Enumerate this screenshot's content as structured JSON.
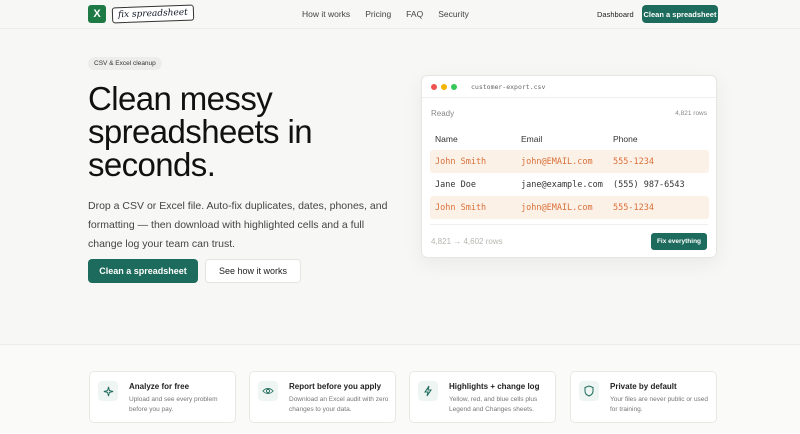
{
  "nav": {
    "logo_icon": "X",
    "logo_text": "fix spreadsheet",
    "links": [
      "How it works",
      "Pricing",
      "FAQ",
      "Security"
    ],
    "dashboard": "Dashboard",
    "cta": "Clean a spreadsheet"
  },
  "hero": {
    "pill": "CSV & Excel cleanup",
    "title": "Clean messy spreadsheets in seconds.",
    "description": "Drop a CSV or Excel file. Auto-fix duplicates, dates, phones, and formatting — then download with highlighted cells and a full change log your team can trust.",
    "primary_button": "Clean a spreadsheet",
    "secondary_button": "See how it works"
  },
  "preview": {
    "filename": "customer-export.csv",
    "status": "Ready",
    "rows_label": "4,821 rows",
    "columns": [
      "Name",
      "Email",
      "Phone"
    ],
    "rows": [
      {
        "name": "John Smith",
        "email": "john@EMAIL.com",
        "phone": "555-1234"
      },
      {
        "name": "Jane Doe",
        "email": "jane@example.com",
        "phone": "(555) 987-6543"
      },
      {
        "name": "John Smith",
        "email": "john@EMAIL.com",
        "phone": "555-1234"
      }
    ],
    "count_label": "4,821 → 4,602 rows",
    "fix_button": "Fix everything"
  },
  "features": [
    {
      "icon": "sparkle-icon",
      "title": "Analyze for free",
      "description": "Upload and see every problem before you pay."
    },
    {
      "icon": "eye-icon",
      "title": "Report before you apply",
      "description": "Download an Excel audit with zero changes to your data."
    },
    {
      "icon": "lightning-icon",
      "title": "Highlights + change log",
      "description": "Yellow, red, and blue cells plus Legend and Changes sheets."
    },
    {
      "icon": "shield-icon",
      "title": "Private by default",
      "description": "Your files are never public or used for training."
    }
  ],
  "colors": {
    "accent": "#1d6b5c",
    "highlight_bg": "#fcf1e6",
    "highlight_text": "#d9703a"
  }
}
